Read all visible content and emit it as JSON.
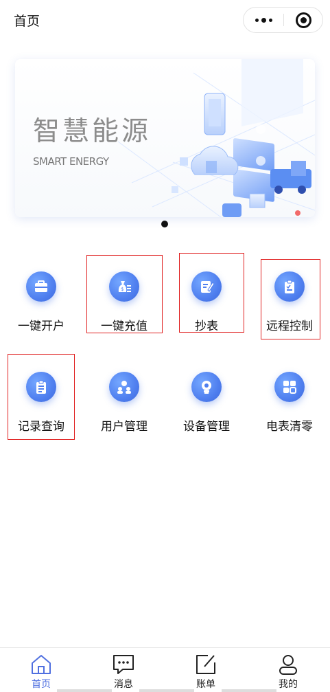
{
  "header": {
    "title": "首页"
  },
  "banner": {
    "title": "智慧能源",
    "subtitle": "SMART ENERGY",
    "page_indicator": 1
  },
  "grid": {
    "items": [
      {
        "label": "一键开户",
        "icon": "briefcase-icon"
      },
      {
        "label": "一键充值",
        "icon": "money-bag-icon"
      },
      {
        "label": "抄表",
        "icon": "edit-note-icon"
      },
      {
        "label": "远程控制",
        "icon": "clipboard-icon"
      },
      {
        "label": "记录查询",
        "icon": "clipboard-list-icon"
      },
      {
        "label": "用户管理",
        "icon": "users-icon"
      },
      {
        "label": "设备管理",
        "icon": "gear-bulb-icon"
      },
      {
        "label": "电表清零",
        "icon": "grid-icon"
      }
    ]
  },
  "tabbar": {
    "active_color": "#4f6fe0",
    "items": [
      {
        "label": "首页",
        "icon": "home-icon",
        "active": true
      },
      {
        "label": "消息",
        "icon": "message-icon",
        "active": false
      },
      {
        "label": "账单",
        "icon": "edit-icon",
        "active": false
      },
      {
        "label": "我的",
        "icon": "user-icon",
        "active": false
      }
    ]
  },
  "colors": {
    "accent": "#4f7fef",
    "highlight_border": "#e01f1f"
  }
}
